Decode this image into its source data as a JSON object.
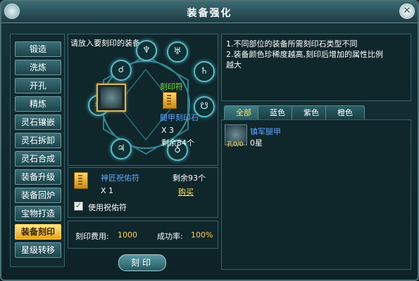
{
  "window": {
    "title": "装备强化",
    "close_icon": "close-icon"
  },
  "sidebar": {
    "items": [
      {
        "label": "锻造"
      },
      {
        "label": "洗炼"
      },
      {
        "label": "开孔"
      },
      {
        "label": "精炼"
      },
      {
        "label": "灵石镶嵌"
      },
      {
        "label": "灵石拆卸"
      },
      {
        "label": "灵石合成"
      },
      {
        "label": "装备升级"
      },
      {
        "label": "装备回炉"
      },
      {
        "label": "宝物打造"
      },
      {
        "label": "装备刻印"
      },
      {
        "label": "星级转移"
      }
    ],
    "active_index": 10
  },
  "center": {
    "hint": "请放入要刻印的装备",
    "rune_label": "刻印符",
    "stone_label": "腿甲刻印石",
    "stone_qty": "X 3",
    "stone_remaining": "剩余84个"
  },
  "blessing": {
    "name": "神匠祝佑符",
    "remaining": "剩余93个",
    "qty": "X 1",
    "buy": "购买",
    "use_label": "使用祝佑符",
    "checked": true
  },
  "cost": {
    "fee_label": "刻印费用:",
    "fee_value": "1000",
    "rate_label": "成功率:",
    "rate_value": "100%"
  },
  "description": {
    "line1": "1.不同部位的装备所需刻印石类型不同",
    "line2": "2.装备颜色珍稀度越高,刻印后增加的属性比例",
    "line3": "越大"
  },
  "tabs": [
    {
      "label": "全部"
    },
    {
      "label": "蓝色"
    },
    {
      "label": "紫色"
    },
    {
      "label": "橙色"
    }
  ],
  "item": {
    "name": "镇军腿甲",
    "stars": "0星",
    "sub": "孔0/0"
  },
  "action": {
    "button_label": "刻印"
  },
  "colors": {
    "accent": "#ffd15a",
    "blue": "#5fa9ff",
    "green": "#7de03c"
  }
}
